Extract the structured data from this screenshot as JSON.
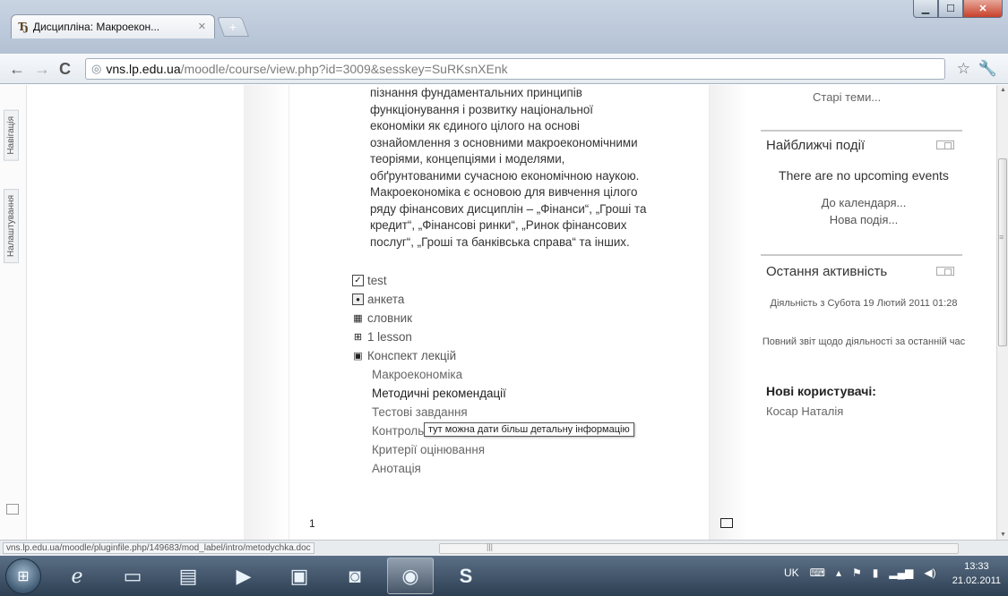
{
  "browser": {
    "tab_title": "Дисципліна: Макроекон...",
    "tab_favicon": "Ђ",
    "url_host": "vns.lp.edu.ua",
    "url_path": "/moodle/course/view.php?id=3009&sesskey=SuRKsnXEnk"
  },
  "left_rail": {
    "nav_label": "Навігація",
    "settings_label": "Налаштування"
  },
  "main": {
    "paragraph_lines": [
      "пізнання фундаментальних принципів",
      "функціонування і розвитку національної",
      "економіки як єдиного цілого на основі",
      "ознайомлення з основними макроекономічними",
      "теоріями, концепціями і моделями,",
      "обґрунтованими сучасною економічною наукою.",
      "Макроекономіка є основою для вивчення цілого",
      "ряду фінансових дисциплін – „Фінанси“, „Гроші та",
      "кредит“, „Фінансові ринки“, „Ринок фінансових",
      "послуг“, „Гроші та банківська справа“ та інших."
    ],
    "activities": [
      {
        "label": "test",
        "icon": "checkbox-icon"
      },
      {
        "label": "анкета",
        "icon": "radio-icon"
      },
      {
        "label": "словник",
        "icon": "glossary-icon"
      },
      {
        "label": "1 lesson",
        "icon": "lesson-icon"
      },
      {
        "label": "Конспект лекцій",
        "icon": "book-icon"
      }
    ],
    "sub_items": [
      "Макроекономіка",
      "Методичні рекомендації",
      "Тестові завдання",
      "Контрольні",
      "Критерії оцінювання",
      "Анотація"
    ],
    "tooltip": "тут можна дати більш детальну інформацію",
    "page_number": "1"
  },
  "right": {
    "old_topics": "Старі теми...",
    "upcoming": {
      "title": "Найближчі події",
      "empty": "There are no upcoming events",
      "to_calendar": "До календаря...",
      "new_event": "Нова подія..."
    },
    "recent": {
      "title": "Остання активність",
      "since": "Діяльність з Субота 19 Лютий 2011 01:28",
      "full_report": "Повний звіт щодо діяльності за останній час",
      "new_users_title": "Нові користувачі:",
      "new_user": "Косар Наталія"
    }
  },
  "status": {
    "url": "vns.lp.edu.ua/moodle/pluginfile.php/149683/mod_label/intro/metodychka.doc",
    "scroll_mark": "|||"
  },
  "taskbar": {
    "lang": "UK",
    "time": "13:33",
    "date": "21.02.2011"
  }
}
